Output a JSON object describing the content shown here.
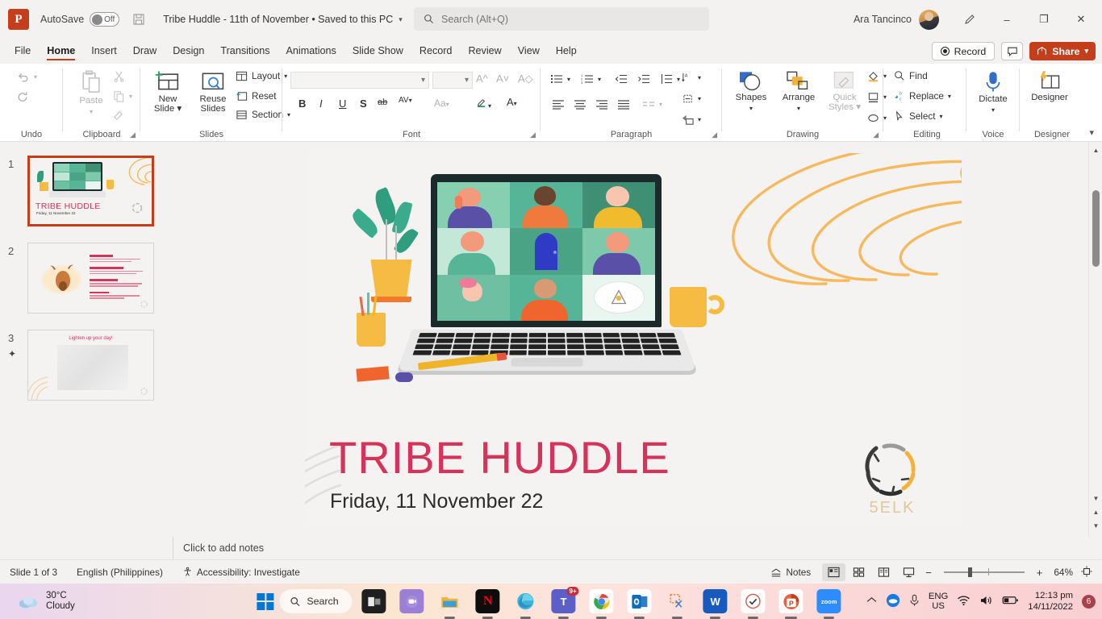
{
  "titlebar": {
    "app_icon": "powerpoint-icon",
    "autosave_label": "AutoSave",
    "autosave_state": "Off",
    "save_icon": "save-icon",
    "document_title": "Tribe Huddle - 11th of November • Saved to this PC",
    "search_placeholder": "Search (Alt+Q)",
    "account_name": "Ara Tancinco",
    "minimize": "–",
    "restore": "❐",
    "close": "✕"
  },
  "tabs": [
    {
      "label": "File",
      "active": false
    },
    {
      "label": "Home",
      "active": true
    },
    {
      "label": "Insert",
      "active": false
    },
    {
      "label": "Draw",
      "active": false
    },
    {
      "label": "Design",
      "active": false
    },
    {
      "label": "Transitions",
      "active": false
    },
    {
      "label": "Animations",
      "active": false
    },
    {
      "label": "Slide Show",
      "active": false
    },
    {
      "label": "Record",
      "active": false
    },
    {
      "label": "Review",
      "active": false
    },
    {
      "label": "View",
      "active": false
    },
    {
      "label": "Help",
      "active": false
    }
  ],
  "tab_actions": {
    "record_label": "Record",
    "comments_label": "Comments",
    "share_label": "Share",
    "share_color": "#c43e1c"
  },
  "ribbon": {
    "groups": [
      {
        "name": "Undo",
        "label": "Undo"
      },
      {
        "name": "Clipboard",
        "label": "Clipboard"
      },
      {
        "name": "Slides",
        "label": "Slides"
      },
      {
        "name": "Font",
        "label": "Font"
      },
      {
        "name": "Paragraph",
        "label": "Paragraph"
      },
      {
        "name": "Drawing",
        "label": "Drawing"
      },
      {
        "name": "Editing",
        "label": "Editing"
      },
      {
        "name": "Voice",
        "label": "Voice"
      },
      {
        "name": "Designer",
        "label": "Designer"
      }
    ],
    "undo_label": "Undo",
    "redo_label": "Redo",
    "paste_label": "Paste",
    "cut_label": "Cut",
    "copy_label": "Copy",
    "format_painter_label": "Format Painter",
    "clipboard_label": "Clipboard",
    "new_slide_label": "New Slide",
    "reuse_slides_label": "Reuse Slides",
    "layout_label": "Layout",
    "reset_label": "Reset",
    "section_label": "Section",
    "slides_label": "Slides",
    "font_name_value": "",
    "font_size_value": "",
    "grow_font": "A",
    "shrink_font": "A",
    "clear_formatting": "A",
    "bold": "B",
    "italic": "I",
    "underline": "U",
    "strikethrough": "S",
    "text_shadow": "ab",
    "char_spacing": "AV",
    "change_case": "Aa",
    "text_highlight": "highlight-icon",
    "font_color": "A",
    "font_label": "Font",
    "paragraph_label": "Paragraph",
    "shapes_label": "Shapes",
    "arrange_label": "Arrange",
    "quick_styles_label": "Quick Styles",
    "drawing_label": "Drawing",
    "find_label": "Find",
    "replace_label": "Replace",
    "select_label": "Select",
    "editing_label": "Editing",
    "dictate_label": "Dictate",
    "voice_label": "Voice",
    "designer_label": "Designer",
    "designer_group_label": "Designer"
  },
  "thumbnails": [
    {
      "number": "1",
      "selected": true,
      "star": false,
      "title": "TRIBE HUDDLE",
      "subtitle": "Friday, 11 November 22"
    },
    {
      "number": "2",
      "selected": false,
      "star": false,
      "title": "",
      "subtitle": ""
    },
    {
      "number": "3",
      "selected": false,
      "star": true,
      "title": "Lighten up your day!",
      "subtitle": ""
    }
  ],
  "slide": {
    "title": "TRIBE HUDDLE",
    "subtitle": "Friday, 11 November 22",
    "title_color": "#d6335c",
    "accent_color": "#f7b95d",
    "logo_text": "5ELK",
    "illustration": "video-call-laptop-illustration"
  },
  "notes": {
    "placeholder": "Click to add notes"
  },
  "statusbar": {
    "slide_counter": "Slide 1 of 3",
    "language": "English (Philippines)",
    "accessibility": "Accessibility: Investigate",
    "notes_label": "Notes",
    "views": [
      "Normal",
      "Slide Sorter",
      "Reading View",
      "Slide Show"
    ],
    "zoom_minus": "−",
    "zoom_plus": "+",
    "zoom_level": "64%",
    "fit_slide": "fit-to-window-icon"
  },
  "taskbar": {
    "weather_temp": "30°C",
    "weather_desc": "Cloudy",
    "start_label": "start-button",
    "search_label": "Search",
    "apps": [
      {
        "name": "task-view-icon",
        "glyph": "◰",
        "bg": "#1f1f1f",
        "active": false
      },
      {
        "name": "messenger-icon",
        "glyph": "●",
        "bg": "#9b7fd4",
        "active": false
      },
      {
        "name": "file-explorer-icon",
        "glyph": "▭",
        "bg": "#f2b33d",
        "active": true
      },
      {
        "name": "netflix-icon",
        "glyph": "N",
        "bg": "#0d0d0d",
        "active": true
      },
      {
        "name": "microsoft-edge-icon",
        "glyph": "●",
        "bg": "#2a9fd6",
        "active": true
      },
      {
        "name": "microsoft-teams-icon",
        "glyph": "T",
        "bg": "#5b5fc7",
        "active": true,
        "badge": "9+"
      },
      {
        "name": "google-chrome-icon",
        "glyph": "●",
        "bg": "#ffffff",
        "active": true
      },
      {
        "name": "outlook-icon",
        "glyph": "O",
        "bg": "#0f6cbd",
        "active": true
      },
      {
        "name": "snipping-tool-icon",
        "glyph": "✂",
        "bg": "#f3f3f3",
        "active": true
      },
      {
        "name": "word-icon",
        "glyph": "W",
        "bg": "#185abd",
        "active": true
      },
      {
        "name": "todo-icon",
        "glyph": "✓",
        "bg": "#ffffff",
        "active": true
      },
      {
        "name": "powerpoint-icon",
        "glyph": "P",
        "bg": "#c43e1c",
        "active": true
      },
      {
        "name": "zoom-icon",
        "glyph": "zoom",
        "bg": "#2d8cff",
        "active": true
      }
    ],
    "tray": {
      "overflow": "^",
      "language": "ENG\nUS",
      "lang_line1": "ENG",
      "lang_line2": "US",
      "wifi": "wifi-icon",
      "volume": "volume-icon",
      "battery": "battery-icon",
      "time": "12:13 pm",
      "date": "14/11/2022",
      "notification_count": "6"
    }
  }
}
